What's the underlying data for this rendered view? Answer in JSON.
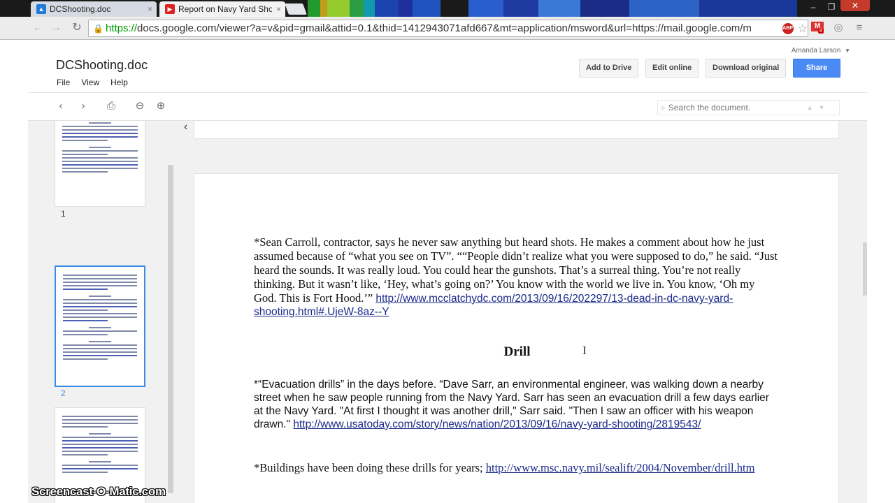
{
  "browser": {
    "tabs": [
      {
        "title": "DCShooting.doc",
        "close": "×",
        "icon": "google-drive-icon"
      },
      {
        "title": "Report on Navy Yard Shoo",
        "close": "×",
        "icon": "youtube-icon"
      }
    ],
    "url_scheme": "https://",
    "url_rest": "docs.google.com/viewer?a=v&pid=gmail&attid=0.1&thid=1412943071afd667&mt=application/msword&url=https://mail.google.com/m",
    "gmail_badge": "8",
    "abp_label": "ABP"
  },
  "viewer": {
    "account": "Amanda Larson",
    "doc_title": "DCShooting.doc",
    "menus": [
      "File",
      "View",
      "Help"
    ],
    "buttons": {
      "add_to_drive": "Add to Drive",
      "edit_online": "Edit online",
      "download_original": "Download original",
      "share": "Share"
    },
    "search_placeholder": "Search the document.",
    "page_numbers": [
      "1",
      "2"
    ]
  },
  "document": {
    "para1_text": "*Sean Carroll, contractor, says he never saw anything but heard shots. He makes a comment about how he just assumed because of “what you see on TV”. ““People didn’t realize what you were supposed to do,” he said. “Just heard the sounds. It was really loud. You could hear the gunshots. That’s a surreal thing. You’re not really thinking. But it wasn’t like, ‘Hey, what’s going on?’ You know with the world we live in. You know, ‘Oh my God. This is Fort Hood.’” ",
    "para1_link": "http://www.mcclatchydc.com/2013/09/16/202297/13-dead-in-dc-navy-yard-shooting.html#.UjeW-8az--Y",
    "heading": "Drill",
    "para2_text": "*“Evacuation drills” in the days before. “Dave Sarr, an environmental engineer, was walking down a nearby street when he saw people running from the Navy Yard. Sarr has seen an evacuation drill a few days earlier at the Navy Yard. \"At first I thought it was another drill,\" Sarr said. \"Then I saw an officer with his weapon drawn.\" ",
    "para2_link": "http://www.usatoday.com/story/news/nation/2013/09/16/navy-yard-shooting/2819543/",
    "para3_text": "*Buildings have been doing these drills for years; ",
    "para3_link": "http://www.msc.navy.mil/sealift/2004/November/drill.htm"
  },
  "watermark": "Screencast-O-Matic.com"
}
